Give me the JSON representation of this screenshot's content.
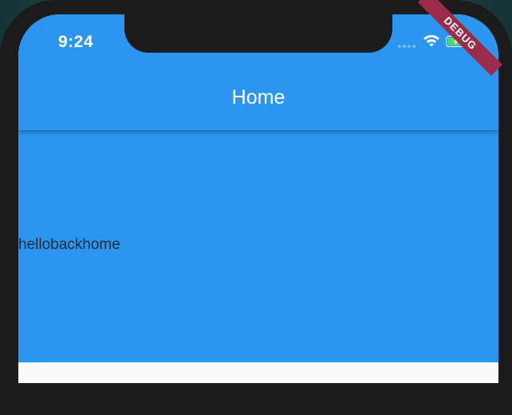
{
  "status_bar": {
    "time": "9:24",
    "icons": [
      "cellular-signal-icon",
      "wifi-icon",
      "battery-charging-icon"
    ]
  },
  "app_bar": {
    "title": "Home"
  },
  "body": {
    "text": "hellobackhome"
  },
  "debug_banner": {
    "label": "DEBUG"
  },
  "colors": {
    "app_bar": "#2b96ef",
    "body_panel": "#2b96ef",
    "background": "#fafafa",
    "debug_banner": "#9b2d4a",
    "battery_fill": "#4cd964"
  }
}
